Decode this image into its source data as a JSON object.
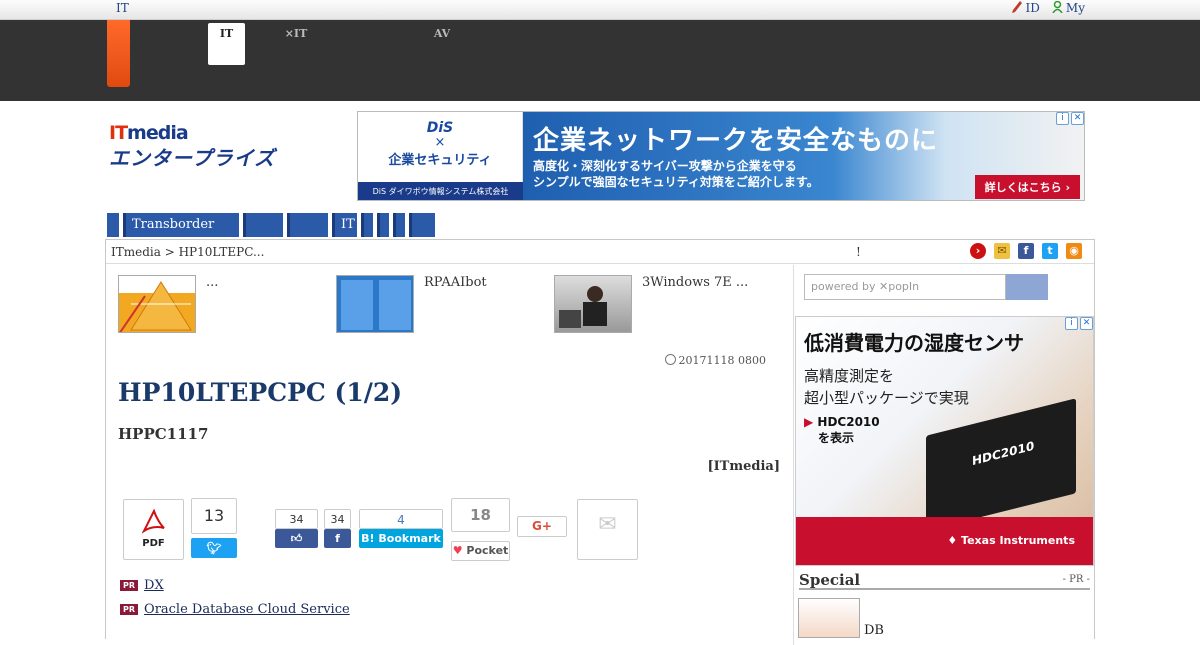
{
  "topbar": {
    "brand": "IT",
    "id_link": "ID",
    "my_link": "My"
  },
  "nav_tabs": [
    {
      "line1": "",
      "line2": "IT"
    },
    {
      "line1": "",
      "line2": "×IT"
    },
    {
      "line1": "AV",
      "line2": ""
    }
  ],
  "logo": {
    "it_prefix": "IT",
    "it_suffix": "media",
    "name": "エンタープライズ"
  },
  "top_ad": {
    "brand": "DiS",
    "x": "×",
    "left_title": "企業セキュリティ",
    "corp": "DiS ダイワボウ情報システム株式会社",
    "headline": "企業ネットワークを安全なものに",
    "sub1": "高度化・深刻化するサイバー攻撃から企業を守る",
    "sub2": "シンプルで強固なセキュリティ対策をご紹介します。",
    "cta": "詳しくはこちら ›"
  },
  "subnav": [
    "",
    "Transborder",
    "",
    "",
    "IT",
    "",
    "",
    "",
    ""
  ],
  "breadcrumb": {
    "home": "ITmedia",
    "sep": " > ",
    "current": "HP10LTEPC...",
    "marker": "!"
  },
  "related": [
    {
      "title": "..."
    },
    {
      "title": "RPAAIbot"
    },
    {
      "title": "3Windows 7E ..."
    }
  ],
  "article": {
    "date": "20171118 0800",
    "title": "HP10LTEPCPC (1/2)",
    "subtitle": "HPPC1117",
    "source": "[ITmedia]"
  },
  "share": {
    "pdf_label": "PDF",
    "tweet_count": "13",
    "fb_like_count": "34",
    "fb_share_count": "34",
    "hatena_count": "4",
    "hatena_label": "Bookmark",
    "pocket_count": "18",
    "pocket_label": "Pocket",
    "gplus_label": "G+"
  },
  "pr_links": [
    {
      "badge": "PR",
      "text": "DX"
    },
    {
      "badge": "PR",
      "text": "Oracle Database Cloud Service"
    }
  ],
  "sidebar": {
    "search_placeholder": "powered by ✕popIn",
    "ad": {
      "headline": "低消費電力の湿度センサ",
      "sub1": "高精度測定を",
      "sub2": "超小型パッケージで実現",
      "cta1": "HDC2010",
      "cta2": "を表示",
      "chip_label": "HDC2010",
      "brand": "Texas Instruments"
    },
    "special_title": "Special",
    "special_pr": "- PR -",
    "special_item": "DB"
  },
  "colors": {
    "accent": "#2a5aa8",
    "dark_header": "#333333",
    "orange": "#f05a1a"
  }
}
